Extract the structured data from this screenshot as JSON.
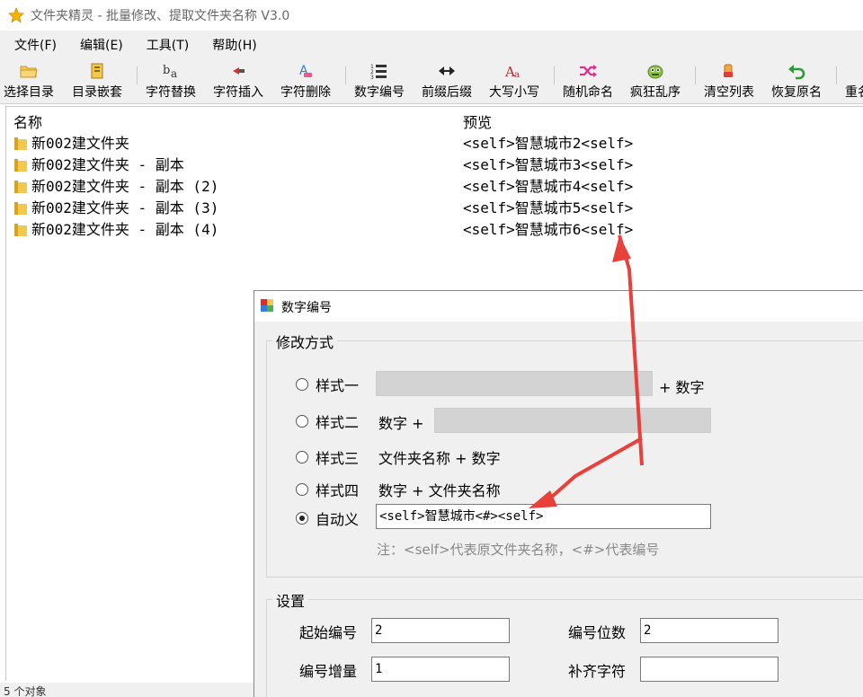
{
  "window": {
    "title": "文件夹精灵 - 批量修改、提取文件夹名称 V3.0"
  },
  "menu": [
    "文件(F)",
    "编辑(E)",
    "工具(T)",
    "帮助(H)"
  ],
  "toolbar": [
    {
      "label": "选择目录",
      "icon": "folder-open-icon"
    },
    {
      "label": "目录嵌套",
      "icon": "nested-folder-icon"
    },
    {
      "label": "字符替换",
      "icon": "replace-chars-icon"
    },
    {
      "label": "字符插入",
      "icon": "insert-chars-icon"
    },
    {
      "label": "字符删除",
      "icon": "delete-chars-icon"
    },
    {
      "label": "数字编号",
      "icon": "numbered-list-icon"
    },
    {
      "label": "前缀后缀",
      "icon": "prefix-suffix-icon"
    },
    {
      "label": "大写小写",
      "icon": "case-icon"
    },
    {
      "label": "随机命名",
      "icon": "shuffle-icon"
    },
    {
      "label": "疯狂乱序",
      "icon": "crazy-face-icon"
    },
    {
      "label": "清空列表",
      "icon": "eraser-icon"
    },
    {
      "label": "恢复原名",
      "icon": "undo-icon"
    },
    {
      "label": "重名",
      "icon": "rename-icon"
    }
  ],
  "list": {
    "headers": {
      "name": "名称",
      "preview": "预览"
    },
    "rows": [
      {
        "name": "新002建文件夹",
        "preview": "<self>智慧城市2<self>"
      },
      {
        "name": "新002建文件夹 - 副本",
        "preview": "<self>智慧城市3<self>"
      },
      {
        "name": "新002建文件夹 - 副本 (2)",
        "preview": "<self>智慧城市4<self>"
      },
      {
        "name": "新002建文件夹 - 副本 (3)",
        "preview": "<self>智慧城市5<self>"
      },
      {
        "name": "新002建文件夹 - 副本 (4)",
        "preview": "<self>智慧城市6<self>"
      }
    ]
  },
  "status": "5 个对象",
  "dialog": {
    "title": "数字编号",
    "mode_group": "修改方式",
    "style1": "样式一",
    "style1_suffix": "+ 数字",
    "style2": "样式二",
    "style2_prefix": "数字 +",
    "style3": "样式三",
    "style3_text": "文件夹名称 + 数字",
    "style4": "样式四",
    "style4_text": "数字 + 文件夹名称",
    "custom": "自动义",
    "custom_value": "<self>智慧城市<#><self>",
    "note": "注：<self>代表原文件夹名称，<#>代表编号",
    "settings_group": "设置",
    "start_label": "起始编号",
    "start_value": "2",
    "digits_label": "编号位数",
    "digits_value": "2",
    "step_label": "编号增量",
    "step_value": "1",
    "pad_label": "补齐字符",
    "pad_value": "",
    "selected": "custom"
  },
  "annotation_color": "#e8413c"
}
